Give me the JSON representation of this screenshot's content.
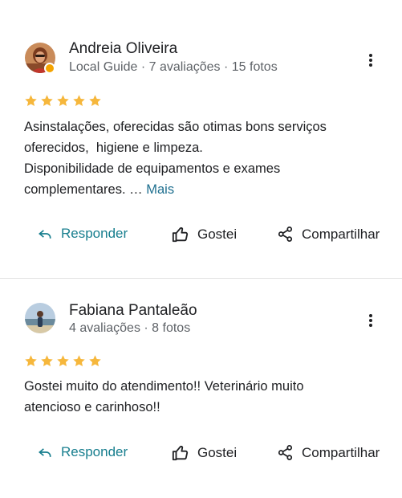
{
  "reviews": [
    {
      "author": "Andreia Oliveira",
      "meta": "Local Guide · 7 avaliações · 15 fotos",
      "rating": 5,
      "text_lines": [
        "Asinstalações, oferecidas são otimas bons serviços",
        "oferecidos,  higiene e limpeza.",
        "Disponibilidade de equipamentos e exames",
        "complementares. … "
      ],
      "more_label": "Mais",
      "actions": {
        "reply": "Responder",
        "like": "Gostei",
        "share": "Compartilhar"
      }
    },
    {
      "author": "Fabiana Pantaleão",
      "meta": "4 avaliações · 8 fotos",
      "rating": 5,
      "text_lines": [
        "Gostei muito do atendimento!! Veterinário muito",
        "atencioso e carinhoso!!"
      ],
      "actions": {
        "reply": "Responder",
        "like": "Gostei",
        "share": "Compartilhar"
      }
    }
  ],
  "colors": {
    "star": "#f6b73c",
    "reply": "#177e8e",
    "link": "#1e6f8f",
    "muted": "#5f6368",
    "text": "#202124",
    "guide_badge": "#f4a300"
  },
  "icons": {
    "more": "more-vert-icon",
    "reply": "reply-arrow-icon",
    "like": "thumb-up-icon",
    "share": "share-icon",
    "star": "star-icon"
  }
}
